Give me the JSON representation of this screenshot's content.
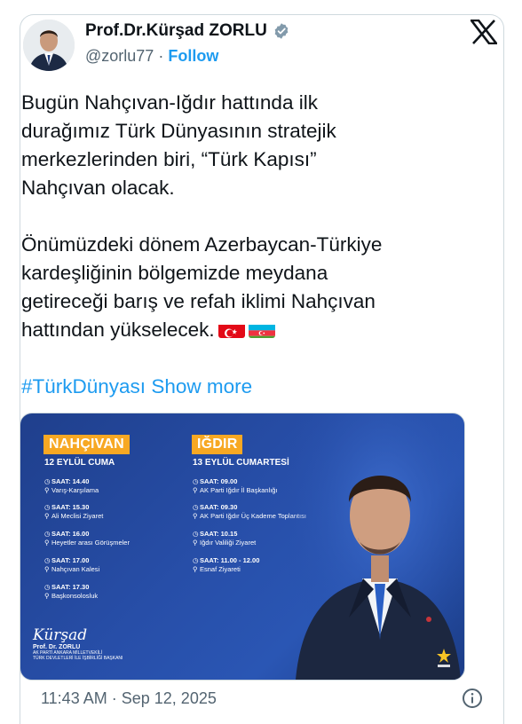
{
  "author": {
    "name": "Prof.Dr.Kürşad ZORLU",
    "handle": "@zorlu77",
    "separator": "·",
    "follow_label": "Follow",
    "verified_icon": "verified-badge-icon"
  },
  "brand_icon": "x-logo-icon",
  "tweet": {
    "line1": "Bugün Nahçıvan-Iğdır hattında ilk",
    "line2": "durağımız Türk Dünyasının stratejik",
    "line3": "merkezlerinden biri, “Türk Kapısı”",
    "line4": "Nahçıvan olacak.",
    "line5": "Önümüzdeki dönem Azerbaycan-Türkiye",
    "line6": "kardeşliğinin bölgemizde meydana",
    "line7": "getireceği barış ve refah iklimi Nahçıvan",
    "line8": "hattından  yükselecek.",
    "flags": [
      "turkey-flag-icon",
      "azerbaijan-flag-icon"
    ],
    "hashtag": "#TürkDünyası",
    "show_more": "Show more"
  },
  "media": {
    "left": {
      "title": "NAHÇIVAN",
      "date": "12 EYLÜL CUMA",
      "items": [
        {
          "time": "SAAT: 14.40",
          "place": "Varış-Karşılama"
        },
        {
          "time": "SAAT: 15.30",
          "place": "Ali Meclisi Ziyaret"
        },
        {
          "time": "SAAT: 16.00",
          "place": "Heyetler arası Görüşmeler"
        },
        {
          "time": "SAAT: 17.00",
          "place": "Nahçıvan Kalesi"
        },
        {
          "time": "SAAT: 17.30",
          "place": "Başkonsolosluk"
        }
      ]
    },
    "right": {
      "title": "IĞDIR",
      "date": "13 EYLÜL CUMARTESİ",
      "items": [
        {
          "time": "SAAT: 09.00",
          "place": "AK Parti Iğdır İl Başkanlığı"
        },
        {
          "time": "SAAT: 09.30",
          "place": "AK Parti Iğdır Üç Kademe Toplantısı"
        },
        {
          "time": "SAAT: 10.15",
          "place": "Iğdır Valiliği Ziyaret"
        },
        {
          "time": "SAAT: 11.00 - 12.00",
          "place": "Esnaf Ziyareti"
        }
      ]
    },
    "signature": {
      "script": "Kürşad",
      "title": "Prof. Dr. ZORLU",
      "line1": "AK PARTİ ANKARA MİLLETVEKİLİ",
      "line2": "TÜRK DEVLETLERİ İLE İŞBİRLİĞİ BAŞKANI"
    },
    "party_logo": "ak-parti-logo-icon"
  },
  "meta": {
    "time": "11:43 AM",
    "separator": "·",
    "date": "Sep 12, 2025",
    "info_icon": "info-icon"
  },
  "colors": {
    "link": "#1d9bf0",
    "muted": "#536471",
    "panel_accent": "#f7a823",
    "panel_bg": "#274ea8"
  }
}
